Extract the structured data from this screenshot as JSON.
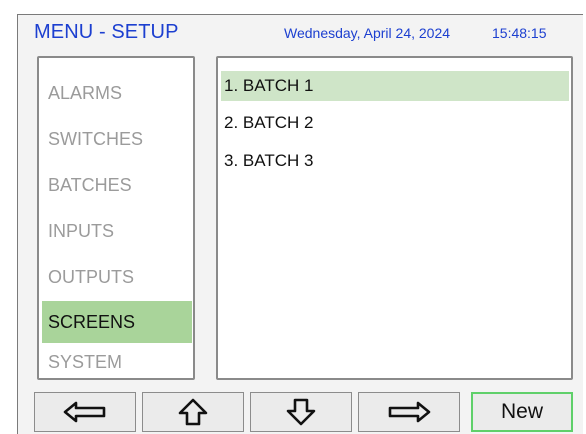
{
  "header": {
    "title": "MENU - SETUP",
    "date": "Wednesday, April 24, 2024",
    "time": "15:48:15"
  },
  "menu": {
    "items": [
      {
        "label": "ALARMS",
        "selected": false
      },
      {
        "label": "SWITCHES",
        "selected": false
      },
      {
        "label": "BATCHES",
        "selected": false
      },
      {
        "label": "INPUTS",
        "selected": false
      },
      {
        "label": "OUTPUTS",
        "selected": false
      },
      {
        "label": "SCREENS",
        "selected": true
      },
      {
        "label": "SYSTEM",
        "selected": false
      }
    ]
  },
  "list": {
    "items": [
      {
        "label": "1. BATCH 1",
        "selected": true
      },
      {
        "label": "2. BATCH 2",
        "selected": false
      },
      {
        "label": "3. BATCH 3",
        "selected": false
      }
    ]
  },
  "toolbar": {
    "buttons": [
      {
        "icon": "arrow-left-icon"
      },
      {
        "icon": "arrow-up-icon"
      },
      {
        "icon": "arrow-down-icon"
      },
      {
        "icon": "arrow-right-icon"
      }
    ],
    "new_label": "New"
  },
  "colors": {
    "accent_text": "#1c3fd0",
    "selected_menu": "#a9d49a",
    "selected_list": "#cfe5c8",
    "new_button_border": "#5fd06a"
  }
}
